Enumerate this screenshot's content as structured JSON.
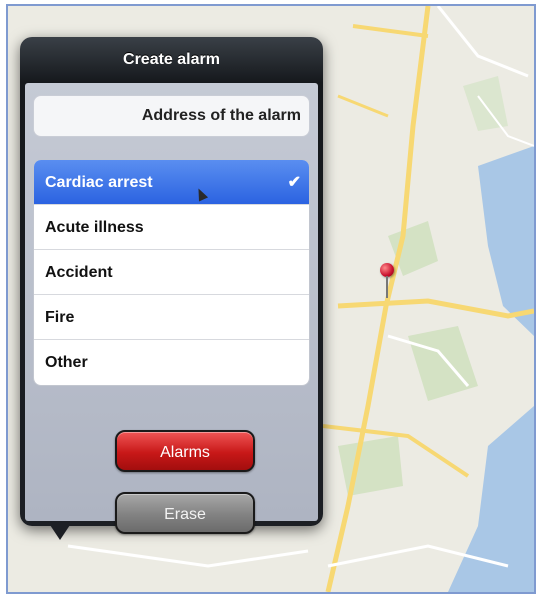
{
  "popover": {
    "title": "Create alarm",
    "address_text": "Address of the alarm"
  },
  "alarm_types": {
    "items": [
      {
        "label": "Cardiac arrest",
        "selected": true
      },
      {
        "label": "Acute illness",
        "selected": false
      },
      {
        "label": "Accident",
        "selected": false
      },
      {
        "label": "Fire",
        "selected": false
      },
      {
        "label": "Other",
        "selected": false
      }
    ],
    "check_glyph": "✔"
  },
  "buttons": {
    "alarms_label": "Alarms",
    "erase_label": "Erase"
  },
  "map": {
    "pin_icon": "map-pin-icon",
    "road_color": "#f7d873",
    "water_color": "#a9c7e6",
    "land_color": "#ecebe3"
  },
  "colors": {
    "selected_row": "#2b63e1",
    "alarms_button": "#c81818",
    "erase_button": "#828282"
  }
}
